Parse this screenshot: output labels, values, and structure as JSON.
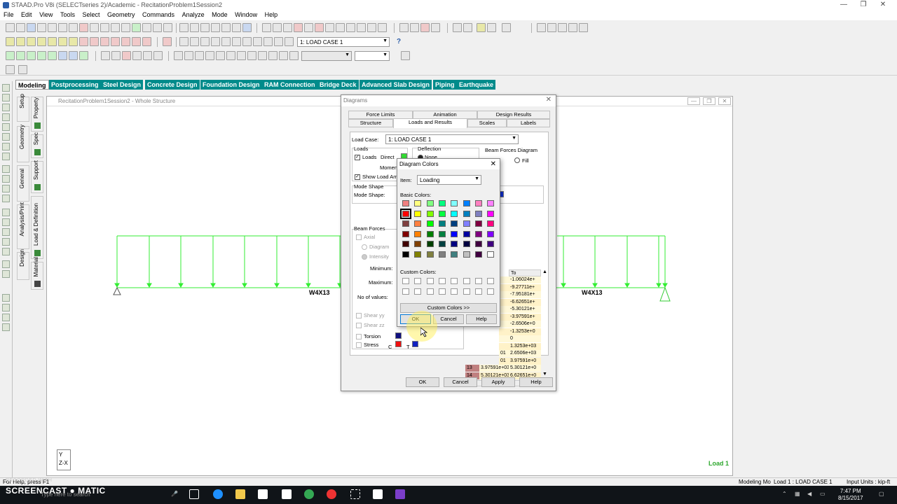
{
  "app": {
    "title": "STAAD.Pro V8i (SELECTseries 2)/Academic - RecitationProblem1Session2",
    "window_controls": [
      "—",
      "❐",
      "✕"
    ]
  },
  "menu": [
    "File",
    "Edit",
    "View",
    "Tools",
    "Select",
    "Geometry",
    "Commands",
    "Analyze",
    "Mode",
    "Window",
    "Help"
  ],
  "toolbar": {
    "loadcase_combo": "1: LOAD CASE 1",
    "help_icon": "?"
  },
  "page_tabs": [
    "Modeling",
    "Postprocessing",
    "Steel Design",
    "Concrete Design",
    "Foundation Design",
    "RAM Connection",
    "Bridge Deck",
    "Advanced Slab Design",
    "Piping",
    "Earthquake"
  ],
  "side_tabs": [
    "Setup",
    "Geometry",
    "General",
    "Analysis/Print",
    "Design"
  ],
  "side_subtabs": [
    "Property",
    "Spec",
    "Support",
    "Load & Definition",
    "Material"
  ],
  "work_window": {
    "title": "RecitationProblem1Session2 - Whole Structure",
    "beam_labels": [
      "W4X13",
      "W4X13"
    ],
    "load_label": "Load 1",
    "axis": {
      "y": "Y",
      "zx": "Z-X"
    }
  },
  "diagrams_dialog": {
    "title": "Diagrams",
    "tabs_row1": [
      "Force Limits",
      "Animation",
      "Design Results"
    ],
    "tabs_row2": [
      "Structure",
      "Loads and Results",
      "Scales",
      "Labels"
    ],
    "load_case_label": "Load Case:",
    "load_case_value": "1: LOAD CASE 1",
    "loads_group": "Loads",
    "loads_check": "Loads",
    "direct": "Direct",
    "moment": "Moment",
    "deflection_group": "Deflection",
    "deflection_none": "None",
    "beam_forces_diagram": "Beam Forces Diagram",
    "fill": "Fill",
    "show_load": "Show Load Am",
    "mode_shape_group": "Mode Shape",
    "mode_shape": "Mode Shape:",
    "beam_forces": "Beam Forces",
    "axial": "Axial",
    "diagram": "Diagram",
    "intensity": "Intensity",
    "minimum": "Minimum:",
    "maximum": "Maximum:",
    "no_of_values": "No of values:",
    "shear_yy": "Shear yy",
    "shear_zz": "Shear zz",
    "torsion": "Torsion",
    "stress": "Stress",
    "c_label": "C",
    "t_label": "T",
    "table_header": "To",
    "table_rows": [
      {
        "idx": "",
        "a": "",
        "b": "-1.06024e+"
      },
      {
        "idx": "",
        "a": "",
        "b": "-9.27711e+"
      },
      {
        "idx": "",
        "a": "",
        "b": "-7.95181e+"
      },
      {
        "idx": "",
        "a": "",
        "b": "-6.62651e+"
      },
      {
        "idx": "",
        "a": "",
        "b": "-5.30121e+"
      },
      {
        "idx": "",
        "a": "",
        "b": "-3.97591e+"
      },
      {
        "idx": "",
        "a": "",
        "b": "-2.6506e+0"
      },
      {
        "idx": "",
        "a": "",
        "b": "-1.3253e+0"
      },
      {
        "idx": "",
        "a": "",
        "b": "0"
      },
      {
        "idx": "",
        "a": "",
        "b": "1.3253e+03"
      },
      {
        "idx": "",
        "a": "01",
        "b": "2.6506e+03"
      },
      {
        "idx": "",
        "a": "01",
        "b": "3.97591e+0"
      },
      {
        "idx": "13",
        "a": "3.97591e+03",
        "b": "5.30121e+0"
      },
      {
        "idx": "14",
        "a": "5.30121e+03",
        "b": "6.62651e+0"
      }
    ],
    "ok": "OK",
    "cancel": "Cancel",
    "apply": "Apply",
    "help": "Help"
  },
  "colors_dialog": {
    "title": "Diagram Colors",
    "item_label": "Item:",
    "item_value": "Loading",
    "basic_colors": "Basic Colors:",
    "custom_colors": "Custom Colors:",
    "define_custom": "Custom Colors >>",
    "ok": "OK",
    "cancel": "Cancel",
    "help": "Help",
    "palette": [
      [
        "#f08080",
        "#ffff80",
        "#80ff80",
        "#00ff80",
        "#80ffff",
        "#0080ff",
        "#ff80c0",
        "#ff80ff"
      ],
      [
        "#ff0000",
        "#ffff00",
        "#80ff00",
        "#00ff40",
        "#00ffff",
        "#0080c0",
        "#8080c0",
        "#ff00ff"
      ],
      [
        "#804040",
        "#ff8040",
        "#00ff00",
        "#008080",
        "#004080",
        "#8080ff",
        "#800040",
        "#ff0080"
      ],
      [
        "#800000",
        "#ff8000",
        "#008000",
        "#008040",
        "#0000ff",
        "#0000a0",
        "#800080",
        "#8000ff"
      ],
      [
        "#400000",
        "#804000",
        "#004000",
        "#004040",
        "#000080",
        "#000040",
        "#400040",
        "#400080"
      ],
      [
        "#000000",
        "#808000",
        "#808040",
        "#808080",
        "#408080",
        "#c0c0c0",
        "#400040",
        "#ffffff"
      ]
    ]
  },
  "status": {
    "left": "For Help, press F1",
    "mode": "Modeling Mo",
    "load": "Load 1 : LOAD CASE 1",
    "units": "Input Units : kip-ft"
  },
  "taskbar": {
    "recorded": "RECORDED WITH",
    "brand": "SCREENCAST ● MATIC",
    "search": "Type here to search",
    "time": "7:47 PM",
    "date": "8/15/2017"
  }
}
